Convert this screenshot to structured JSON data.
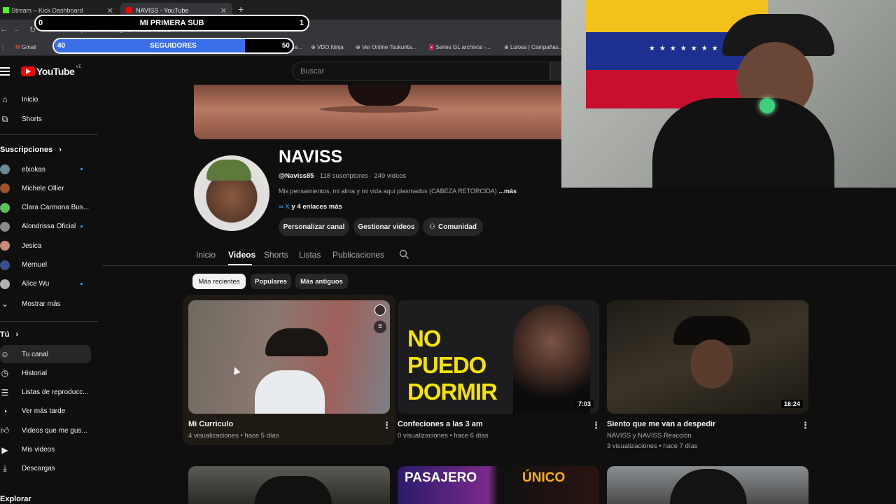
{
  "browser": {
    "tabs": [
      {
        "label": "Stream – Kick Dashboard",
        "active": false
      },
      {
        "label": "NAVISS - YouTube",
        "active": true
      }
    ],
    "new_tab": "+",
    "url": "youtube.com/@Naviss85/videos",
    "bookmarks": [
      "Gmail",
      "Pro Evolution Socce...",
      "VDO.Ninja",
      "Ver Online Tsukurita...",
      "Series GL archivos -...",
      "Lulosa | Campañas..."
    ]
  },
  "overlay": {
    "sub_goal": {
      "start": "0",
      "label": "MI PRIMERA SUB",
      "end": "1"
    },
    "follower_goal": {
      "current": "40",
      "label": "SEGUIDORES",
      "target": "50",
      "progress": 0.8
    }
  },
  "youtube": {
    "logo": "YouTube",
    "country": "VE",
    "search_placeholder": "Buscar",
    "sidebar": {
      "main": [
        {
          "label": "Inicio",
          "icon": "home-icon"
        },
        {
          "label": "Shorts",
          "icon": "shorts-icon"
        }
      ],
      "subs_header": "Suscripciones",
      "subs": [
        {
          "label": "elxokas",
          "dot": true,
          "color": "#6a8a9a"
        },
        {
          "label": "Michele Ollier",
          "dot": false,
          "color": "#a0522d"
        },
        {
          "label": "Clara Carmona Bus...",
          "dot": false,
          "color": "#5fbf5f"
        },
        {
          "label": "Alondrissa Oficial",
          "dot": true,
          "color": "#8a8a8a"
        },
        {
          "label": "Jesica",
          "dot": false,
          "color": "#c88a7a"
        },
        {
          "label": "Mernuel",
          "dot": false,
          "color": "#3b4f8f"
        },
        {
          "label": "Alice Wu",
          "dot": true,
          "color": "#b0b0b0"
        }
      ],
      "show_more": "Mostrar más",
      "you_header": "Tú",
      "you_items": [
        {
          "label": "Tu canal",
          "icon": "user-icon",
          "selected": true
        },
        {
          "label": "Historial",
          "icon": "history-icon",
          "selected": false
        },
        {
          "label": "Listas de reproducc...",
          "icon": "playlist-icon",
          "selected": false
        },
        {
          "label": "Ver más tarde",
          "icon": "clock-icon",
          "selected": false
        },
        {
          "label": "Videos que me gus...",
          "icon": "thumbs-up-icon",
          "selected": false
        },
        {
          "label": "Mis videos",
          "icon": "video-icon",
          "selected": false
        },
        {
          "label": "Descargas",
          "icon": "download-icon",
          "selected": false
        }
      ],
      "explore_header": "Explorar"
    },
    "channel": {
      "name": "NAVISS",
      "handle": "@Naviss85",
      "stats": "· 118 suscriptores · 249 videos",
      "description": "Mis pensamientos, mi alma y mi vida aqui plasmados (CABEZA RETORCIDA)",
      "more": "...más",
      "links_prefix": "X",
      "links": "y 4 enlaces más",
      "buttons": [
        "Personalizar canal",
        "Gestionar videos",
        "Comunidad"
      ]
    },
    "tabs": [
      "Inicio",
      "Videos",
      "Shorts",
      "Listas",
      "Publicaciones"
    ],
    "active_tab": "Videos",
    "chips": [
      "Más recientes",
      "Populares",
      "Más antiguos"
    ],
    "videos": [
      {
        "title": "Mi Curriculo",
        "channel": "",
        "meta": "4 visualizaciones • hace 5 días",
        "duration": ""
      },
      {
        "title": "Confeciones a las 3 am",
        "channel": "",
        "meta": "0 visualizaciones • hace 6 días",
        "duration": "7:03",
        "thumb_text": "NO PUEDO DORMIR"
      },
      {
        "title": "Siento que me van a despedir",
        "channel": "NAVISS y NAVISS Reacción",
        "meta": "3 visualizaciones • hace 7 días",
        "duration": "16:24"
      }
    ],
    "row2_thumb_texts": [
      "PASAJERO",
      "ÚNICO"
    ]
  },
  "colors": {
    "bg": "#0f0f0f",
    "chip_active": "#f1f1f1",
    "link": "#3ea6ff",
    "yt_red": "#ff0000",
    "progress": "#3b6fe8",
    "thumb_yellow": "#f5e400"
  }
}
